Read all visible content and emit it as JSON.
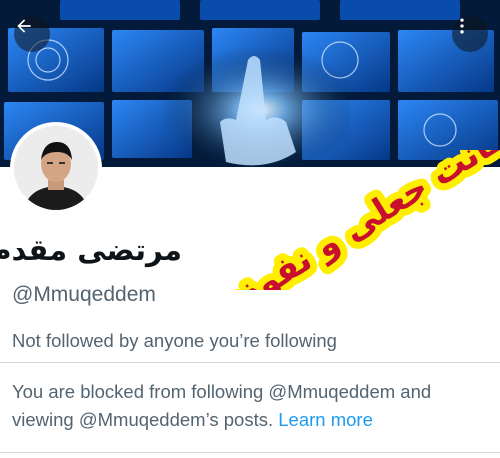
{
  "profile": {
    "display_name": "مرتضی مقدم",
    "handle": "@Mmuqeddem",
    "follow_note": "Not followed by anyone you’re following"
  },
  "blocked_notice": {
    "text": "You are blocked from following @Mmuqeddem and viewing @Mmuqeddem’s posts.",
    "link_label": "Learn more"
  },
  "overlay_stamp": {
    "text": "اکانت جعلی و نفوذی",
    "text_color": "#c8102e",
    "fill_color": "#ffee00"
  },
  "icons": {
    "back": "arrow-left-icon",
    "more": "more-vertical-icon"
  },
  "colors": {
    "link": "#1d9bf0",
    "secondary_text": "#536471",
    "banner_glow": "#1e7bff"
  }
}
